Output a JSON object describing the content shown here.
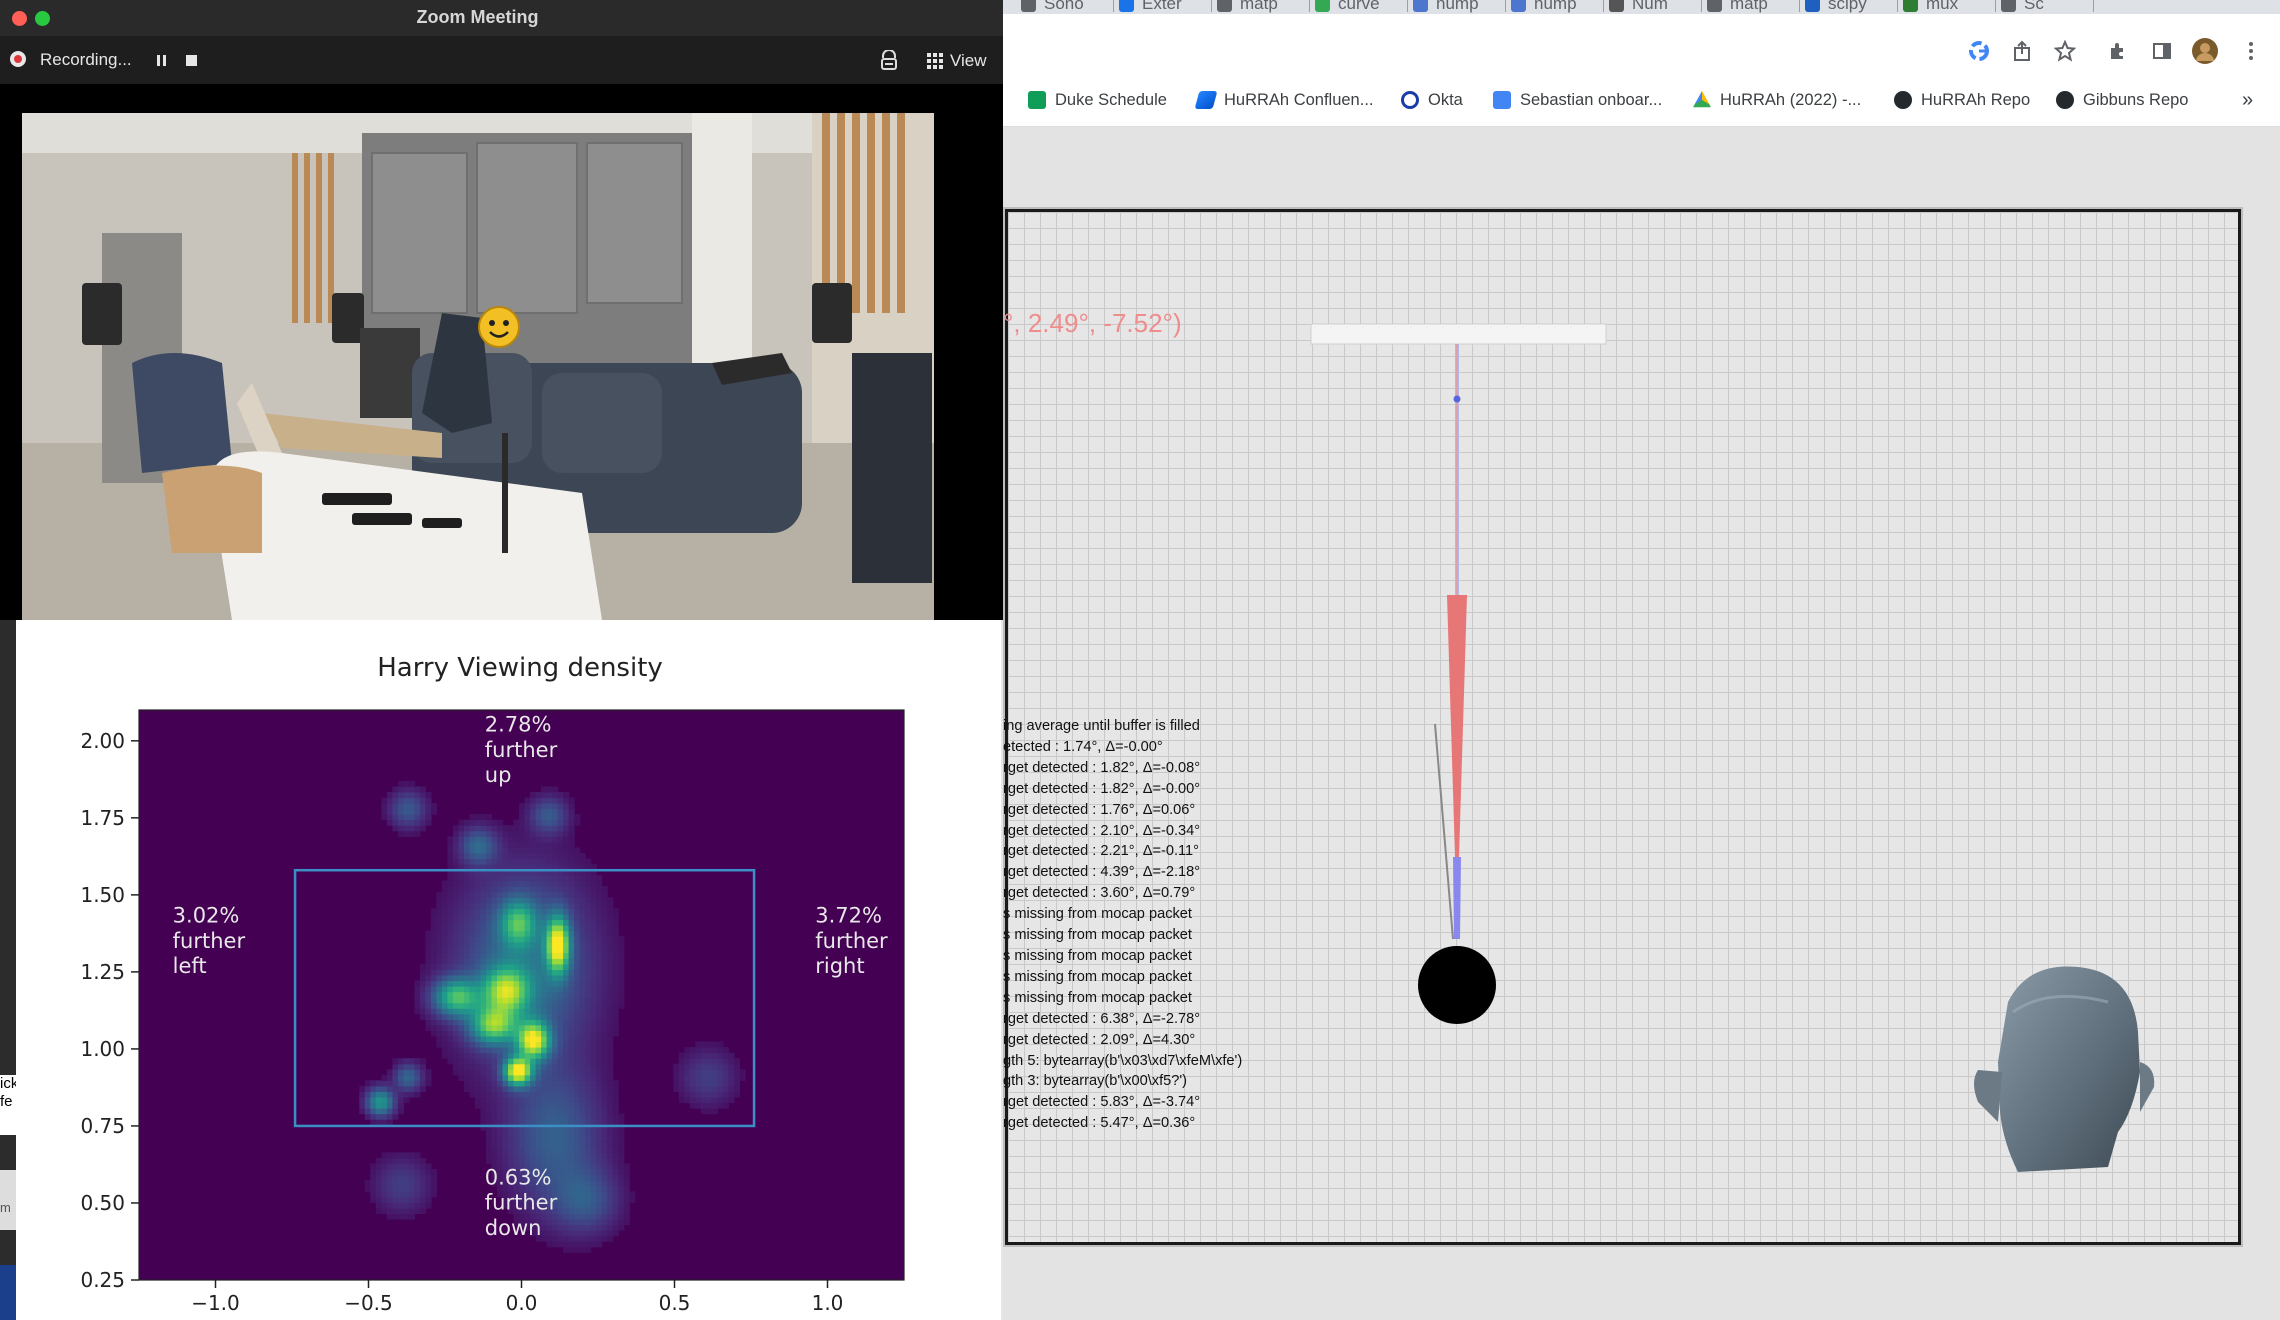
{
  "zoom": {
    "window_title": "Zoom Meeting",
    "recording_label": "Recording...",
    "view_label": "View"
  },
  "browser": {
    "tabs": [
      "Sono",
      "Exter",
      "matp",
      "curve",
      "nump",
      "nump",
      "Num",
      "matp",
      "scipy",
      "mux",
      "Sc"
    ],
    "bookmarks": [
      "Duke Schedule",
      "HuRRAh Confluen...",
      "Okta",
      "Sebastian onboar...",
      "HuRRAh (2022) -...",
      "HuRRAh Repo",
      "Gibbuns Repo"
    ],
    "bookmarks_more": "»"
  },
  "viewer": {
    "angle_readout": "°, 2.49°, -7.52°)",
    "log_lines": [
      "ing average until buffer is filled",
      "etected : 1.74°, Δ=-0.00°",
      "rget detected : 1.82°, Δ=-0.08°",
      "rget detected : 1.82°, Δ=-0.00°",
      "rget detected : 1.76°, Δ=0.06°",
      "rget detected : 2.10°, Δ=-0.34°",
      "rget detected : 2.21°, Δ=-0.11°",
      "rget detected : 4.39°, Δ=-2.18°",
      "rget detected : 3.60°, Δ=0.79°",
      "s missing from mocap packet",
      "s missing from mocap packet",
      "s missing from mocap packet",
      "s missing from mocap packet",
      "s missing from mocap packet",
      "rget detected : 6.38°, Δ=-2.78°",
      "rget detected : 2.09°, Δ=4.30°",
      "gth 5: bytearray(b'\\x03\\xd7\\xfeM\\xfe')",
      "gth 3: bytearray(b'\\x00\\xf5?')",
      "rget detected : 5.83°, Δ=-3.74°",
      "rget detected : 5.47°, Δ=0.36°"
    ]
  },
  "side_strip": {
    "fragments": [
      "ick",
      "fe",
      "m"
    ]
  },
  "chart_data": {
    "type": "heatmap",
    "title": "Harry Viewing density",
    "xlabel": "",
    "ylabel": "",
    "xlim": [
      -1.25,
      1.25
    ],
    "ylim": [
      0.25,
      2.1
    ],
    "xticks": [
      -1.0,
      -0.5,
      0.0,
      0.5,
      1.0
    ],
    "xtick_labels": [
      "−1.0",
      "−0.5",
      "0.0",
      "0.5",
      "1.0"
    ],
    "yticks": [
      0.25,
      0.5,
      0.75,
      1.0,
      1.25,
      1.5,
      1.75,
      2.0
    ],
    "ytick_labels": [
      "0.25",
      "0.50",
      "0.75",
      "1.00",
      "1.25",
      "1.50",
      "1.75",
      "2.00"
    ],
    "colormap": "viridis",
    "rectangle": {
      "x0": -0.74,
      "x1": 0.76,
      "y0": 0.75,
      "y1": 1.58,
      "color": "#3a8fc4"
    },
    "annotations": [
      {
        "text": "2.78%\nfurther\nup",
        "x": -0.12,
        "y": 2.03
      },
      {
        "text": "3.02%\nfurther\nleft",
        "x": -1.14,
        "y": 1.41
      },
      {
        "text": "3.72%\nfurther\nright",
        "x": 0.96,
        "y": 1.41
      },
      {
        "text": "0.63%\nfurther\ndown",
        "x": -0.12,
        "y": 0.56
      }
    ],
    "hotspots": [
      {
        "x": -0.02,
        "y": 0.92,
        "sx": 0.03,
        "sy": 0.03,
        "w": 1.0
      },
      {
        "x": 0.03,
        "y": 1.02,
        "sx": 0.035,
        "sy": 0.04,
        "w": 0.9
      },
      {
        "x": 0.11,
        "y": 1.33,
        "sx": 0.025,
        "sy": 0.06,
        "w": 0.95
      },
      {
        "x": -0.06,
        "y": 1.18,
        "sx": 0.05,
        "sy": 0.05,
        "w": 0.7
      },
      {
        "x": -0.22,
        "y": 1.16,
        "sx": 0.05,
        "sy": 0.04,
        "w": 0.6
      },
      {
        "x": -0.1,
        "y": 1.07,
        "sx": 0.05,
        "sy": 0.04,
        "w": 0.65
      },
      {
        "x": -0.02,
        "y": 1.4,
        "sx": 0.04,
        "sy": 0.05,
        "w": 0.5
      },
      {
        "x": 0.0,
        "y": 1.25,
        "sx": 0.14,
        "sy": 0.2,
        "w": 0.3
      },
      {
        "x": 0.1,
        "y": 0.7,
        "sx": 0.1,
        "sy": 0.15,
        "w": 0.22
      },
      {
        "x": 0.2,
        "y": 0.5,
        "sx": 0.07,
        "sy": 0.07,
        "w": 0.18
      },
      {
        "x": -0.47,
        "y": 0.82,
        "sx": 0.03,
        "sy": 0.03,
        "w": 0.45
      },
      {
        "x": -0.38,
        "y": 0.9,
        "sx": 0.03,
        "sy": 0.03,
        "w": 0.25
      },
      {
        "x": -0.15,
        "y": 1.65,
        "sx": 0.04,
        "sy": 0.04,
        "w": 0.25
      },
      {
        "x": 0.08,
        "y": 1.75,
        "sx": 0.04,
        "sy": 0.04,
        "w": 0.2
      },
      {
        "x": -0.38,
        "y": 1.77,
        "sx": 0.04,
        "sy": 0.04,
        "w": 0.2
      },
      {
        "x": 0.6,
        "y": 0.9,
        "sx": 0.06,
        "sy": 0.06,
        "w": 0.12
      },
      {
        "x": -0.4,
        "y": 0.55,
        "sx": 0.06,
        "sy": 0.06,
        "w": 0.12
      }
    ]
  }
}
